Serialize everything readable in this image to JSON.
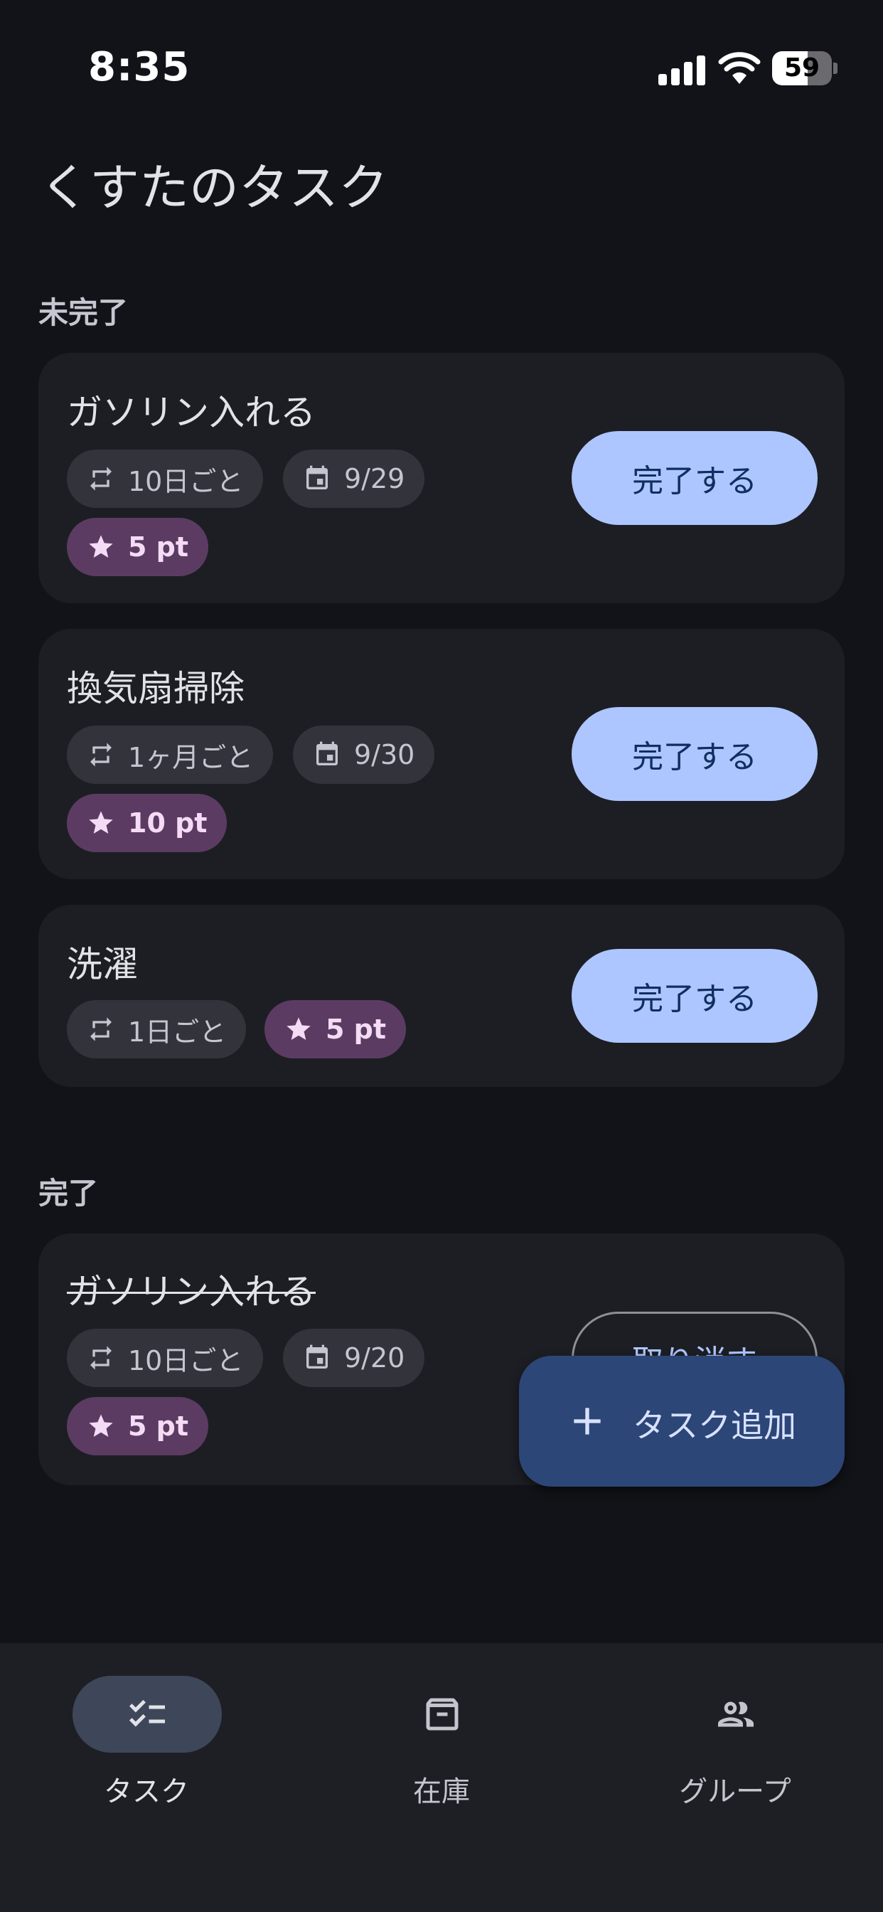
{
  "status_bar": {
    "time": "8:35",
    "battery": "59",
    "battery_level": 0.59
  },
  "header": {
    "title": "くすたのタスク"
  },
  "sections": {
    "incomplete": "未完了",
    "complete": "完了"
  },
  "incomplete_tasks": [
    {
      "name": "ガソリン入れる",
      "repeat": "10日ごと",
      "due": "9/29",
      "points": "5 pt",
      "action": "完了する"
    },
    {
      "name": "換気扇掃除",
      "repeat": "1ヶ月ごと",
      "due": "9/30",
      "points": "10 pt",
      "action": "完了する"
    },
    {
      "name": "洗濯",
      "repeat": "1日ごと",
      "points": "5 pt",
      "action": "完了する"
    }
  ],
  "complete_tasks": [
    {
      "name": "ガソリン入れる",
      "repeat": "10日ごと",
      "due": "9/20",
      "points": "5 pt",
      "action": "取り消す"
    }
  ],
  "fab": {
    "label": "タスク追加",
    "icon": "plus-icon"
  },
  "bottom_nav": [
    {
      "label": "タスク",
      "icon": "checklist-icon",
      "active": true
    },
    {
      "label": "在庫",
      "icon": "archive-icon",
      "active": false
    },
    {
      "label": "グループ",
      "icon": "people-icon",
      "active": false
    }
  ],
  "colors": {
    "background": "#121318",
    "card": "#1d1e24",
    "primary_button": "#adc6ff",
    "points_chip": "#5c3b62",
    "fab": "#2c4677",
    "nav_active": "#3e4759"
  }
}
